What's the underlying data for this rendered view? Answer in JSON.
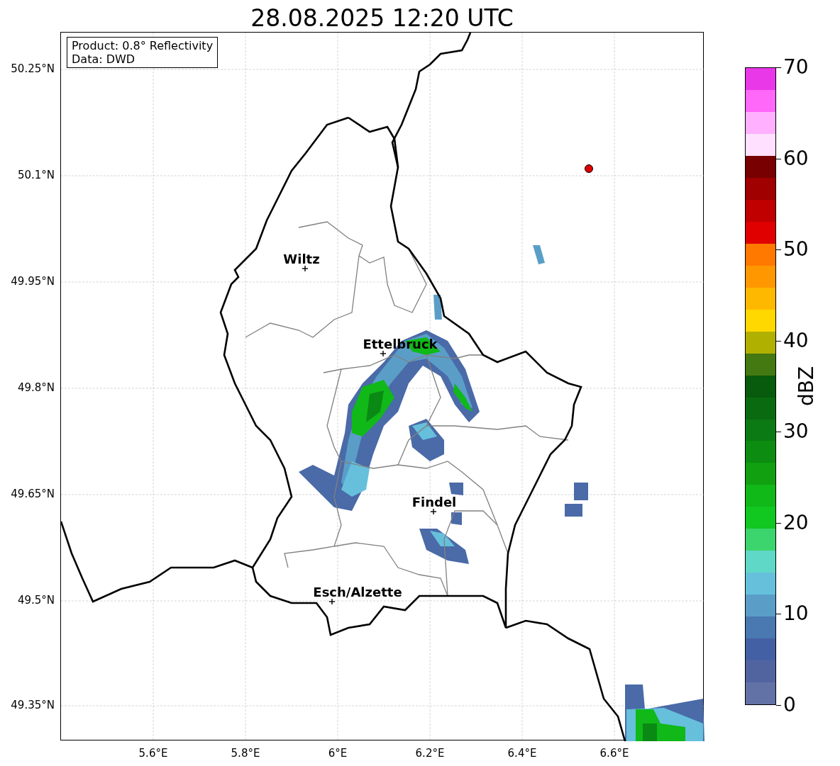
{
  "title": "28.08.2025 12:20 UTC",
  "info_box": {
    "lines": [
      "Product: 0.8° Reflectivity",
      "Data: DWD"
    ]
  },
  "map": {
    "lat_labels": [
      "50.25°N",
      "50.1°N",
      "49.95°N",
      "49.8°N",
      "49.65°N",
      "49.5°N",
      "49.35°N"
    ],
    "lon_labels": [
      "5.6°E",
      "5.8°E",
      "6°E",
      "6.2°E",
      "6.4°E",
      "6.6°E"
    ],
    "places": [
      {
        "name": "Wiltz"
      },
      {
        "name": "Ettelbruck"
      },
      {
        "name": "Findel"
      },
      {
        "name": "Esch/Alzette"
      }
    ]
  },
  "colorbar": {
    "label": "dBZ",
    "ticks": [
      "70",
      "60",
      "50",
      "40",
      "30",
      "20",
      "10",
      "0"
    ],
    "bins": [
      {
        "color": "#6272a6"
      },
      {
        "color": "#5264a0"
      },
      {
        "color": "#4460a4"
      },
      {
        "color": "#4a78b0"
      },
      {
        "color": "#5a9ec8"
      },
      {
        "color": "#66c0dc"
      },
      {
        "color": "#60d8c8"
      },
      {
        "color": "#3cd46c"
      },
      {
        "color": "#10c820"
      },
      {
        "color": "#10b818"
      },
      {
        "color": "#10a010"
      },
      {
        "color": "#0c8c10"
      },
      {
        "color": "#0c7a14"
      },
      {
        "color": "#0a6a10"
      },
      {
        "color": "#085a0c"
      },
      {
        "color": "#447810"
      },
      {
        "color": "#b0b000"
      },
      {
        "color": "#ffd800"
      },
      {
        "color": "#ffb800"
      },
      {
        "color": "#ff9800"
      },
      {
        "color": "#ff7800"
      },
      {
        "color": "#e00000"
      },
      {
        "color": "#c00000"
      },
      {
        "color": "#a00000"
      },
      {
        "color": "#780000"
      },
      {
        "color": "#ffe0ff"
      },
      {
        "color": "#ffb0ff"
      },
      {
        "color": "#ff68f8"
      },
      {
        "color": "#e838e8"
      }
    ]
  }
}
